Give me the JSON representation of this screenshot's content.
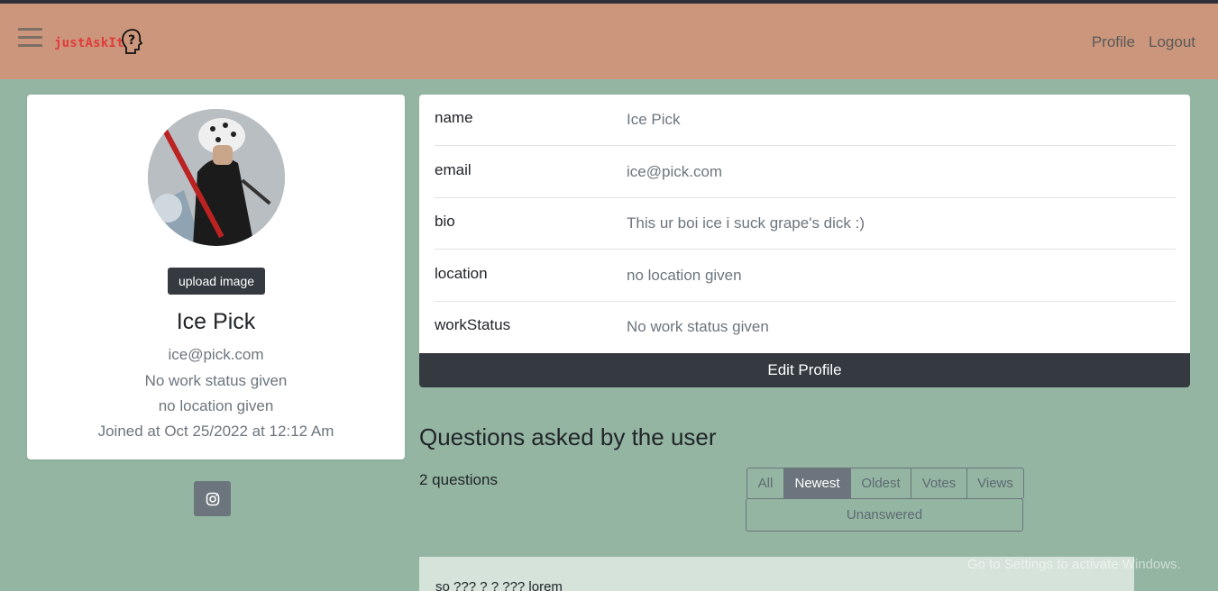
{
  "header": {
    "brand": "justAskIt",
    "nav": {
      "profile": "Profile",
      "logout": "Logout"
    }
  },
  "profile_card": {
    "upload_label": "upload image",
    "name": "Ice Pick",
    "email": "ice@pick.com",
    "work_status": "No work status given",
    "location": "no location given",
    "joined": "Joined at Oct 25/2022 at 12:12 Am"
  },
  "info": {
    "rows": [
      {
        "label": "name",
        "value": "Ice Pick"
      },
      {
        "label": "email",
        "value": "ice@pick.com"
      },
      {
        "label": "bio",
        "value": "This ur boi ice i suck grape's dick :)"
      },
      {
        "label": "location",
        "value": "no location given"
      },
      {
        "label": "workStatus",
        "value": "No work status given"
      }
    ],
    "edit_label": "Edit Profile"
  },
  "questions": {
    "title": "Questions asked by the user",
    "count": "2 questions",
    "filters": [
      "All",
      "Newest",
      "Oldest",
      "Votes",
      "Views"
    ],
    "active_filter": "Newest",
    "unanswered": "Unanswered",
    "first_question_title": "so ??? ? ? ??? lorem"
  },
  "os_overlay": {
    "activate_hint": "Go to Settings to activate Windows."
  },
  "colors": {
    "navbar": "#cb967b",
    "page_bg": "#93b5a2",
    "brand": "#e23b3b",
    "dark_button": "#343a40",
    "secondary": "#6c757d"
  }
}
